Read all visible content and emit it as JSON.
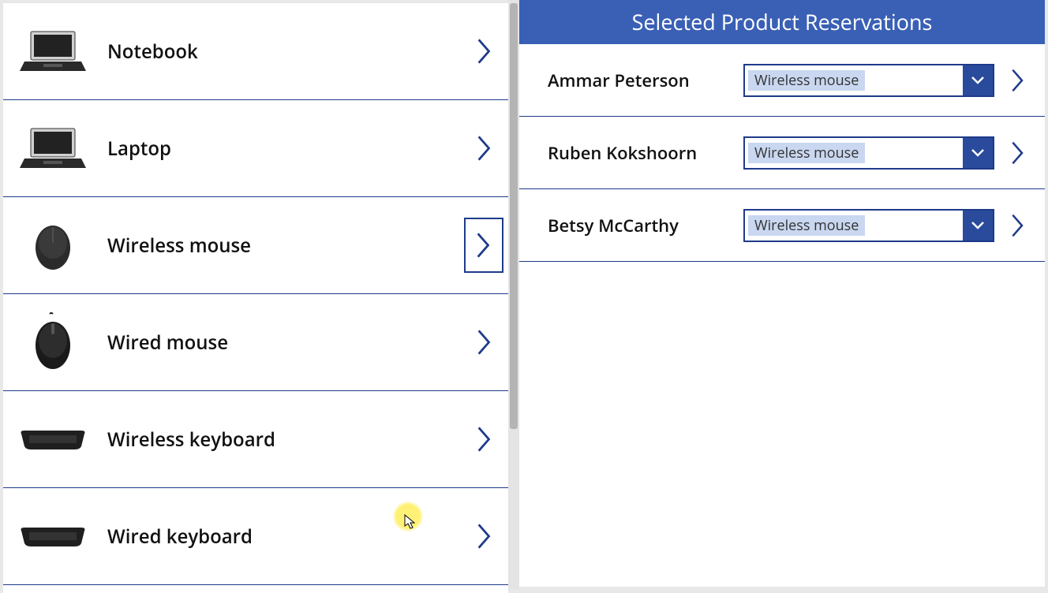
{
  "products": [
    {
      "label": "Notebook",
      "thumb": "laptop-open",
      "selected": false
    },
    {
      "label": "Laptop",
      "thumb": "laptop-angle",
      "selected": false
    },
    {
      "label": "Wireless mouse",
      "thumb": "mouse-wireless",
      "selected": true
    },
    {
      "label": "Wired mouse",
      "thumb": "mouse-wired",
      "selected": false
    },
    {
      "label": "Wireless keyboard",
      "thumb": "keyboard",
      "selected": false
    },
    {
      "label": "Wired keyboard",
      "thumb": "keyboard",
      "selected": false
    }
  ],
  "right": {
    "title": "Selected Product Reservations",
    "reservations": [
      {
        "name": "Ammar Peterson",
        "product": "Wireless mouse"
      },
      {
        "name": "Ruben Kokshoorn",
        "product": "Wireless mouse"
      },
      {
        "name": "Betsy McCarthy",
        "product": "Wireless mouse"
      }
    ]
  }
}
